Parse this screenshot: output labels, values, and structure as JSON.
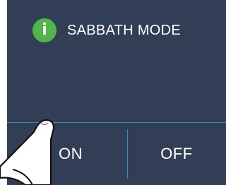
{
  "panel": {
    "title": "SABBATH MODE",
    "info_icon": "info-icon",
    "colors": {
      "background": "#323e55",
      "accent": "#3f86c0",
      "icon": "#52b54c",
      "text": "#ffffff"
    }
  },
  "buttons": {
    "on_label": "ON",
    "off_label": "OFF"
  },
  "overlay": {
    "hand_icon": "pointing-finger"
  }
}
